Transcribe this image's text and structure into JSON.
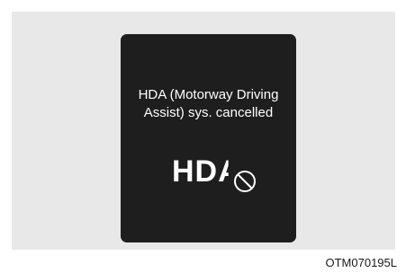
{
  "display": {
    "message_line1": "HDA (Motorway Driving",
    "message_line2": "Assist) sys. cancelled",
    "indicator_text": "HDA",
    "indicator_icon": "no-entry-icon"
  },
  "caption": "OTM070195L",
  "colors": {
    "panel_background": "#e8e8e8",
    "screen_background": "#1e1e1e",
    "text": "#ffffff"
  }
}
